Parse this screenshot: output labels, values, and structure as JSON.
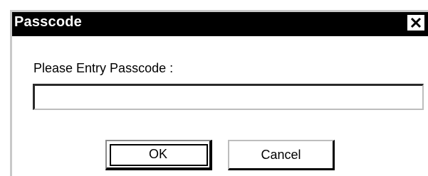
{
  "window": {
    "title": "Passcode",
    "close_icon": "close-icon"
  },
  "form": {
    "prompt_label": "Please Entry Passcode :",
    "passcode_value": "",
    "passcode_placeholder": ""
  },
  "buttons": {
    "ok_label": "OK",
    "cancel_label": "Cancel"
  },
  "colors": {
    "titlebar": "#000000",
    "title_text": "#ffffff",
    "background": "#ffffff"
  }
}
